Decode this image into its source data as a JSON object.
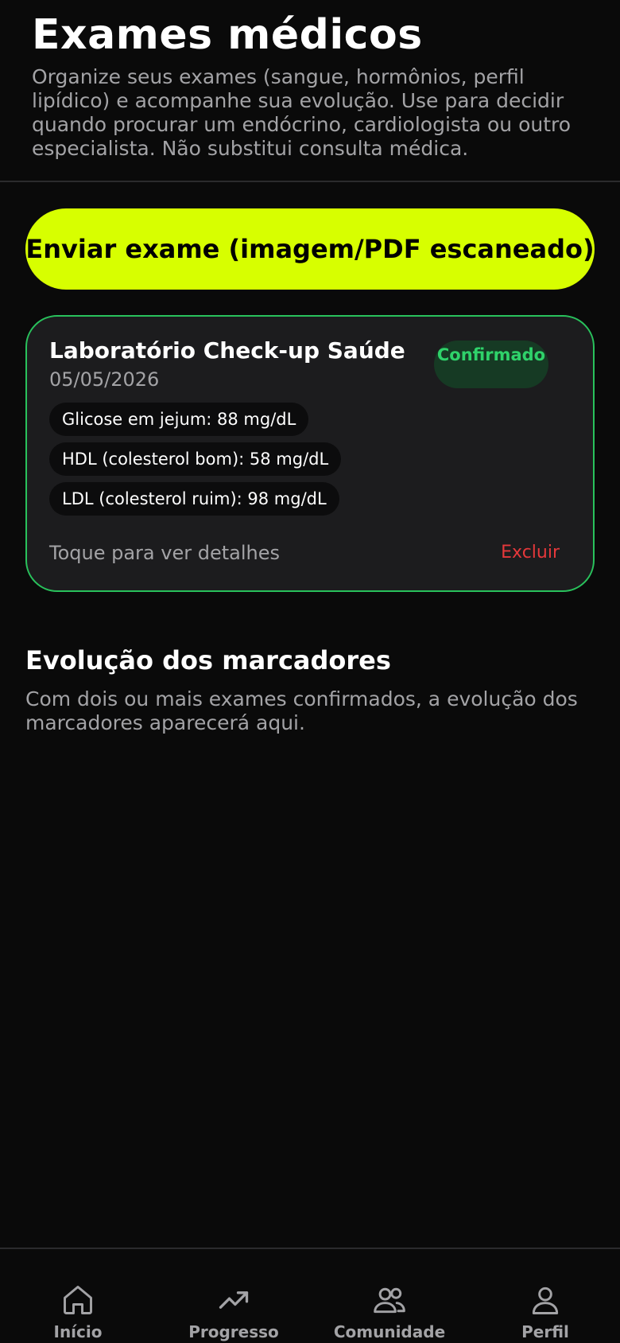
{
  "header": {
    "title": "Exames médicos",
    "subtitle": "Organize seus exames (sangue, hormônios, perfil lipídico) e acompanhe sua evolução. Use para decidir quando procurar um endócrino, cardiologista ou outro especialista. Não substitui consulta médica."
  },
  "upload": {
    "label": "Enviar exame (imagem/PDF escaneado)",
    "color": "#d7ff00"
  },
  "exam": {
    "lab_name": "Laboratório Check-up Saúde",
    "date": "05/05/2026",
    "status": "Confirmado",
    "status_color": "#2fd26a",
    "markers": [
      "Glicose em jejum: 88 mg/dL",
      "HDL (colesterol bom): 58 mg/dL",
      "LDL (colesterol ruim): 98 mg/dL"
    ],
    "details_hint": "Toque para ver detalhes",
    "delete_label": "Excluir",
    "delete_color": "#e5383b"
  },
  "evolution": {
    "title": "Evolução dos marcadores",
    "note": "Com dois ou mais exames confirmados, a evolução dos marcadores aparecerá aqui."
  },
  "nav": {
    "items": [
      {
        "icon": "home-icon",
        "label": "Início"
      },
      {
        "icon": "trending-up-icon",
        "label": "Progresso"
      },
      {
        "icon": "users-icon",
        "label": "Comunidade"
      },
      {
        "icon": "user-icon",
        "label": "Perfil"
      }
    ]
  }
}
